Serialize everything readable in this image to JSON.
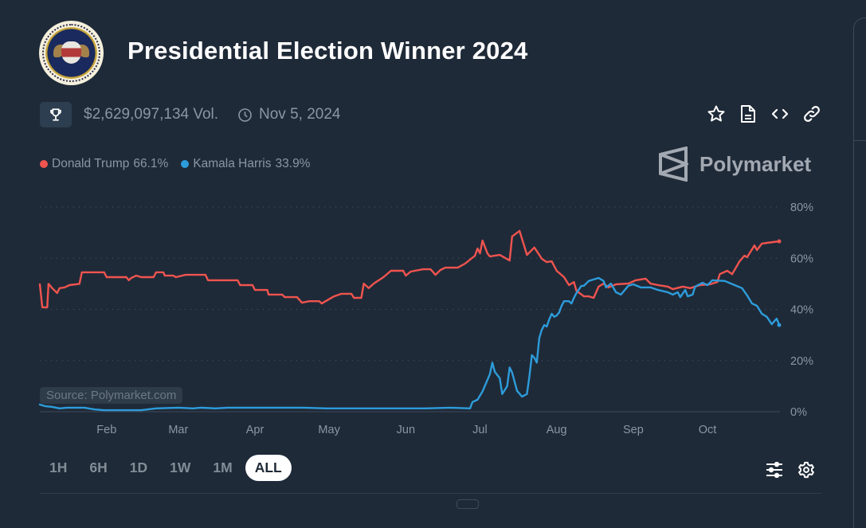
{
  "header": {
    "title": "Presidential Election Winner 2024",
    "volume": "$2,629,097,134 Vol.",
    "end_date": "Nov 5, 2024"
  },
  "icons": {
    "seal": "presidential-seal-image",
    "trophy": "trophy-icon",
    "clock": "clock-icon",
    "actions": [
      "star-icon",
      "document-icon",
      "code-icon",
      "link-icon"
    ],
    "tools": [
      "sliders-icon",
      "gear-icon"
    ]
  },
  "legend": [
    {
      "name": "Donald Trump",
      "value": "66.1%",
      "color": "#f0544f"
    },
    {
      "name": "Kamala Harris",
      "value": "33.9%",
      "color": "#2d9cdb"
    }
  ],
  "brand": "Polymarket",
  "source_label": "Source: Polymarket.com",
  "time_ranges": [
    {
      "label": "1H",
      "active": false
    },
    {
      "label": "6H",
      "active": false
    },
    {
      "label": "1D",
      "active": false
    },
    {
      "label": "1W",
      "active": false
    },
    {
      "label": "1M",
      "active": false
    },
    {
      "label": "ALL",
      "active": true
    }
  ],
  "colors": {
    "background": "#1f2a38",
    "trump": "#f0544f",
    "harris": "#2d9cdb",
    "axis_text": "#8b96a3"
  },
  "chart_data": {
    "type": "line",
    "title": "Presidential Election Winner 2024",
    "xlabel": "",
    "ylabel": "",
    "x_unit": "day of year 2024",
    "xlim": [
      4,
      303
    ],
    "ylim": [
      0,
      80
    ],
    "yticks": [
      0,
      20,
      40,
      60,
      80
    ],
    "ytick_labels": [
      "0%",
      "20%",
      "40%",
      "60%",
      "80%"
    ],
    "xticks": [
      {
        "label": "Feb",
        "day": 31
      },
      {
        "label": "Mar",
        "day": 60
      },
      {
        "label": "Apr",
        "day": 91
      },
      {
        "label": "May",
        "day": 121
      },
      {
        "label": "Jun",
        "day": 152
      },
      {
        "label": "Jul",
        "day": 182
      },
      {
        "label": "Aug",
        "day": 213
      },
      {
        "label": "Sep",
        "day": 244
      },
      {
        "label": "Oct",
        "day": 274
      }
    ],
    "grid": "horizontal dotted",
    "legend_position": "top-left",
    "series": [
      {
        "name": "Donald Trump",
        "color": "#f0544f",
        "points": [
          [
            4,
            49.8
          ],
          [
            5,
            40.8
          ],
          [
            6,
            40.8
          ],
          [
            7,
            40.8
          ],
          [
            7.5,
            50
          ],
          [
            9,
            48.3
          ],
          [
            11,
            46.4
          ],
          [
            12,
            48.3
          ],
          [
            14,
            48.6
          ],
          [
            16,
            49.5
          ],
          [
            20,
            50
          ],
          [
            21,
            54.5
          ],
          [
            30,
            54.5
          ],
          [
            31,
            52.6
          ],
          [
            39,
            52.6
          ],
          [
            40,
            51.4
          ],
          [
            41,
            52.3
          ],
          [
            43,
            53.2
          ],
          [
            45,
            52.6
          ],
          [
            50,
            52.6
          ],
          [
            51,
            54.5
          ],
          [
            54,
            54.5
          ],
          [
            54.5,
            53.2
          ],
          [
            58,
            53.2
          ],
          [
            59,
            52.6
          ],
          [
            63,
            53.5
          ],
          [
            71,
            53.5
          ],
          [
            72,
            51.4
          ],
          [
            84,
            51.4
          ],
          [
            85,
            49.5
          ],
          [
            90,
            49.5
          ],
          [
            91,
            47.6
          ],
          [
            96,
            47.6
          ],
          [
            96.5,
            45.8
          ],
          [
            102,
            45.8
          ],
          [
            103,
            44.8
          ],
          [
            108,
            44.8
          ],
          [
            110,
            42.6
          ],
          [
            113,
            43.2
          ],
          [
            117,
            43.2
          ],
          [
            118,
            42.3
          ],
          [
            123,
            45.1
          ],
          [
            126,
            46.1
          ],
          [
            130,
            46.1
          ],
          [
            131,
            44.5
          ],
          [
            134,
            44.5
          ],
          [
            135,
            50.1
          ],
          [
            137,
            48.3
          ],
          [
            139,
            50.1
          ],
          [
            143,
            52.6
          ],
          [
            146,
            55.1
          ],
          [
            151,
            55.1
          ],
          [
            152,
            53.2
          ],
          [
            154,
            54.8
          ],
          [
            159,
            55.7
          ],
          [
            162,
            55.7
          ],
          [
            164,
            53.5
          ],
          [
            166,
            55.4
          ],
          [
            168,
            56.3
          ],
          [
            173,
            56.3
          ],
          [
            176,
            57.9
          ],
          [
            180,
            61
          ],
          [
            181,
            63.8
          ],
          [
            182,
            61.9
          ],
          [
            183,
            66.9
          ],
          [
            185,
            61.9
          ],
          [
            186,
            60.7
          ],
          [
            190,
            61.3
          ],
          [
            194,
            59.1
          ],
          [
            195,
            68.5
          ],
          [
            198,
            70.7
          ],
          [
            200,
            64.5
          ],
          [
            201,
            61.3
          ],
          [
            204,
            64.2
          ],
          [
            206,
            61.3
          ],
          [
            207,
            59.8
          ],
          [
            209,
            58.5
          ],
          [
            211,
            58.8
          ],
          [
            213,
            55.1
          ],
          [
            216,
            52.6
          ],
          [
            218,
            49.5
          ],
          [
            220,
            50.7
          ],
          [
            221,
            47.3
          ],
          [
            224,
            45.1
          ],
          [
            226,
            45.1
          ],
          [
            228,
            44.5
          ],
          [
            230,
            48.9
          ],
          [
            232,
            50.1
          ],
          [
            234,
            48.6
          ],
          [
            237,
            49.8
          ],
          [
            242,
            50.1
          ],
          [
            245,
            51.4
          ],
          [
            249,
            52
          ],
          [
            251,
            50.1
          ],
          [
            254,
            49.5
          ],
          [
            258,
            48.9
          ],
          [
            260,
            47.9
          ],
          [
            264,
            48.9
          ],
          [
            267,
            48.3
          ],
          [
            271,
            49.5
          ],
          [
            275,
            49.8
          ],
          [
            278,
            50.7
          ],
          [
            279,
            53.8
          ],
          [
            282,
            55.1
          ],
          [
            284,
            53.8
          ],
          [
            287,
            58.8
          ],
          [
            289,
            61
          ],
          [
            290,
            60.4
          ],
          [
            293,
            65
          ],
          [
            294,
            63.2
          ],
          [
            296,
            65.7
          ],
          [
            298,
            66
          ],
          [
            303,
            66.6
          ]
        ]
      },
      {
        "name": "Kamala Harris",
        "color": "#2d9cdb",
        "points": [
          [
            4,
            2.8
          ],
          [
            6,
            2.2
          ],
          [
            9,
            1.9
          ],
          [
            12,
            1.3
          ],
          [
            15,
            1.6
          ],
          [
            22,
            1.6
          ],
          [
            26,
            0.9
          ],
          [
            30,
            0.6
          ],
          [
            45,
            0.6
          ],
          [
            51,
            1.3
          ],
          [
            60,
            1.6
          ],
          [
            66,
            1.3
          ],
          [
            69,
            1.6
          ],
          [
            75,
            1.3
          ],
          [
            80,
            1.6
          ],
          [
            100,
            1.6
          ],
          [
            110,
            1.6
          ],
          [
            120,
            1.3
          ],
          [
            140,
            1.3
          ],
          [
            150,
            1.3
          ],
          [
            160,
            1.3
          ],
          [
            170,
            1.6
          ],
          [
            178,
            1.3
          ],
          [
            179,
            3.8
          ],
          [
            181,
            4.7
          ],
          [
            183,
            7.9
          ],
          [
            186,
            14.7
          ],
          [
            187,
            19.2
          ],
          [
            188,
            15.6
          ],
          [
            190,
            13.1
          ],
          [
            191,
            6.9
          ],
          [
            193,
            10
          ],
          [
            194,
            17.3
          ],
          [
            195,
            15.3
          ],
          [
            197,
            8.2
          ],
          [
            199,
            5.9
          ],
          [
            201,
            6.9
          ],
          [
            202,
            13.8
          ],
          [
            203,
            22.1
          ],
          [
            204,
            21.1
          ],
          [
            205,
            19.2
          ],
          [
            206,
            28.8
          ],
          [
            207,
            32
          ],
          [
            208,
            33.9
          ],
          [
            209,
            33.3
          ],
          [
            210,
            36.1
          ],
          [
            211,
            38.3
          ],
          [
            212,
            37.1
          ],
          [
            213,
            37.6
          ],
          [
            214,
            38.8
          ],
          [
            215,
            41.4
          ],
          [
            216,
            43.2
          ],
          [
            218,
            43.2
          ],
          [
            219,
            42.3
          ],
          [
            220,
            44.5
          ],
          [
            221,
            46.4
          ],
          [
            223,
            49.2
          ],
          [
            224,
            49.2
          ],
          [
            226,
            51.1
          ],
          [
            228,
            51.7
          ],
          [
            230,
            52.3
          ],
          [
            232,
            51.1
          ],
          [
            233,
            48.6
          ],
          [
            235,
            50.1
          ],
          [
            237,
            46.7
          ],
          [
            239,
            45.8
          ],
          [
            242,
            49.2
          ],
          [
            244,
            49.8
          ],
          [
            247,
            48.6
          ],
          [
            251,
            48.6
          ],
          [
            254,
            47.6
          ],
          [
            258,
            46.7
          ],
          [
            260,
            45.8
          ],
          [
            262,
            46.7
          ],
          [
            263,
            44.8
          ],
          [
            265,
            47.6
          ],
          [
            266,
            45.1
          ],
          [
            268,
            45.8
          ],
          [
            269,
            48.9
          ],
          [
            272,
            50.4
          ],
          [
            274,
            49.5
          ],
          [
            276,
            51.4
          ],
          [
            281,
            51.1
          ],
          [
            285,
            49.5
          ],
          [
            288,
            48.3
          ],
          [
            290,
            45.5
          ],
          [
            292,
            42.3
          ],
          [
            294,
            41.4
          ],
          [
            296,
            38.3
          ],
          [
            298,
            37.1
          ],
          [
            300,
            34.2
          ],
          [
            302,
            36.4
          ],
          [
            303,
            33.9
          ]
        ]
      }
    ]
  }
}
